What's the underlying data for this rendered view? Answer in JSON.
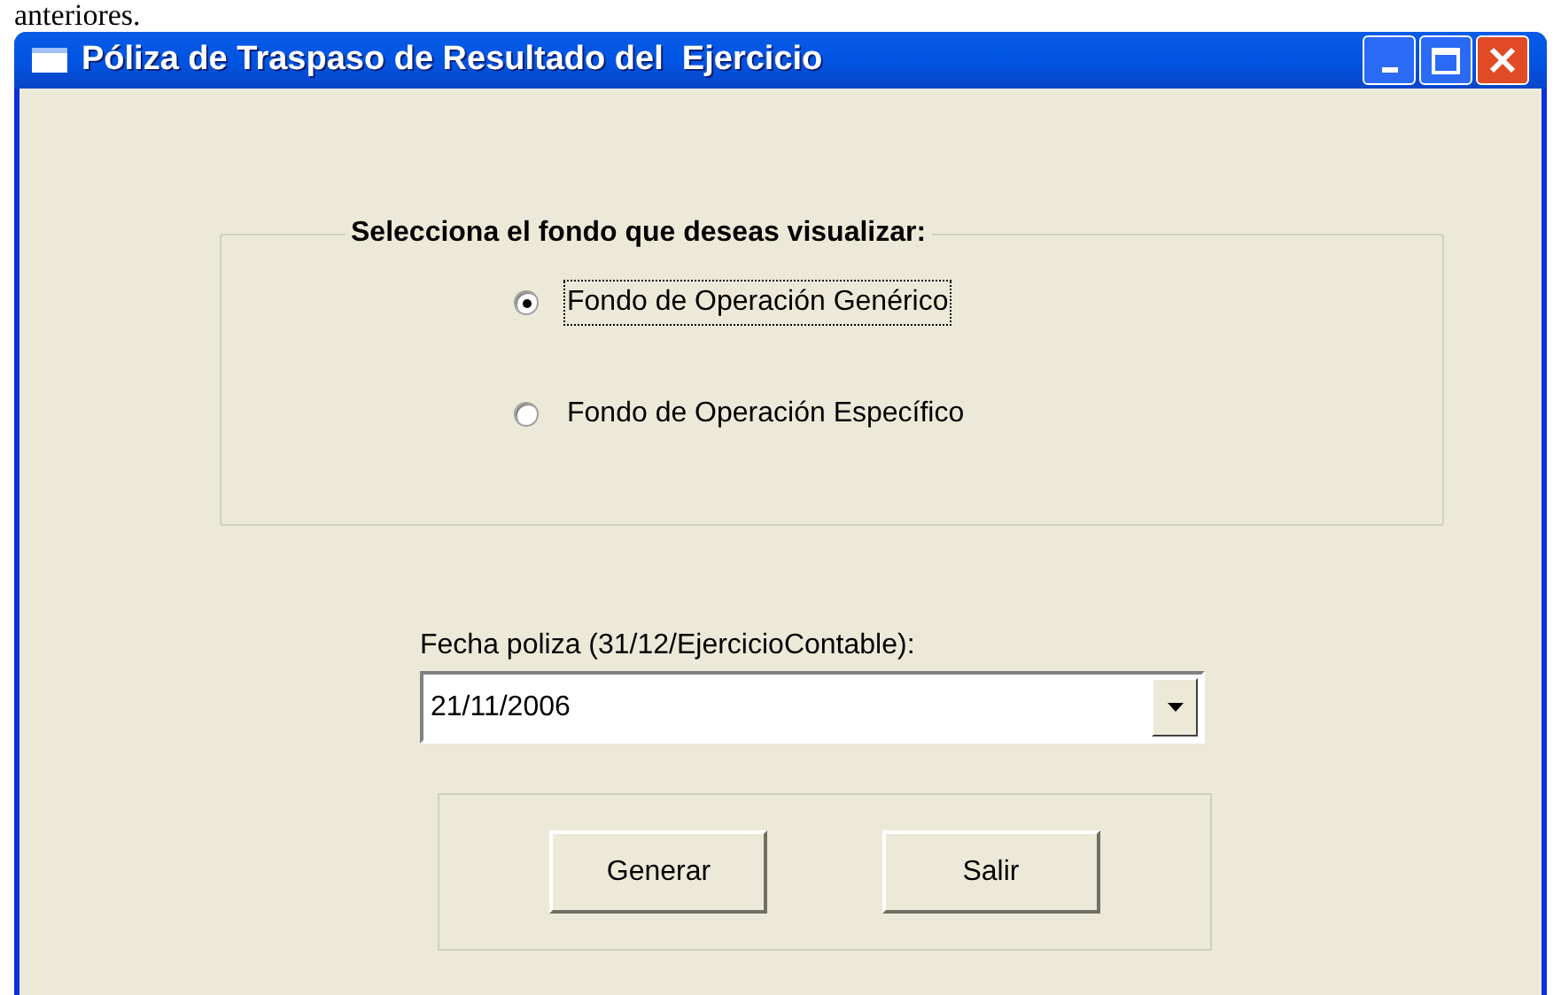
{
  "page_text": "anteriores.",
  "window": {
    "title": "Póliza de Traspaso de Resultado del  Ejercicio"
  },
  "group": {
    "legend": "Selecciona el fondo que deseas visualizar:",
    "options": [
      {
        "label": "Fondo de Operación Genérico",
        "selected": true
      },
      {
        "label": "Fondo de Operación Específico",
        "selected": false
      }
    ]
  },
  "date_field": {
    "label": "Fecha poliza (31/12/EjercicioContable):",
    "value": "21/11/2006"
  },
  "buttons": [
    "Generar",
    "Salir"
  ]
}
